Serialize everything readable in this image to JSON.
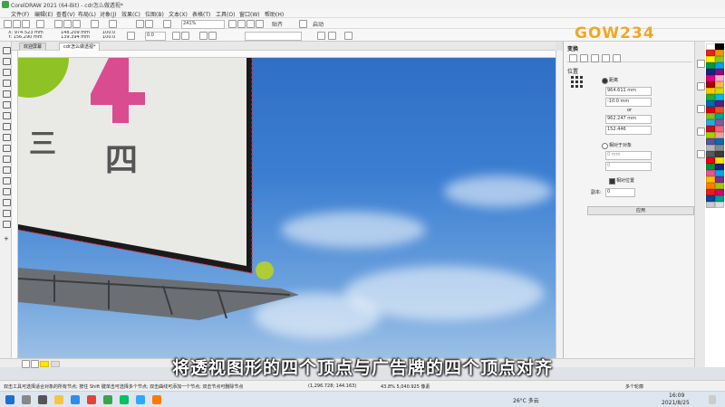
{
  "window": {
    "title": "CorelDRAW 2021 (64-Bit) - cdr怎么做透视*"
  },
  "menu": [
    "文件(F)",
    "编辑(E)",
    "查看(V)",
    "布局(L)",
    "对象(J)",
    "效果(C)",
    "位图(B)",
    "文本(X)",
    "表格(T)",
    "工具(O)",
    "窗口(W)",
    "帮助(H)"
  ],
  "toolbar": {
    "zoom": "241%",
    "snap_label": "贴齐",
    "launch_label": "启动"
  },
  "propbar": {
    "x": "X: 974.523 mm",
    "y": "Y: 156.290 mm",
    "w": "148.209 mm",
    "h": "139.394 mm",
    "sx": "100.0",
    "sy": "100.0",
    "pct": "%",
    "angle": "0.0"
  },
  "tabs": [
    "欢迎屏幕",
    "cdr怎么做透视*"
  ],
  "panel": {
    "header": "变换",
    "section": "位置",
    "distance_label": "距离",
    "x_val": "964.611 mm",
    "y_val": "-10.0 mm",
    "or_label": "or",
    "len_val": "962.247 mm",
    "angle_val": "152.446",
    "relative_label": "相对于对象",
    "dist2": "0 mm",
    "ang2": "0",
    "relpos_label": "相对位置",
    "copies_label": "副本:",
    "copies_val": "0",
    "apply_label": "应用"
  },
  "billboard": {
    "line1": "三",
    "line2": "四"
  },
  "subtitle": "将透视图形的四个顶点与广告牌的四个顶点对齐",
  "watermark": "GOW234",
  "status": {
    "hint": "双击工具可选择适合对象的所有节点; 按住 Shift 键单击可选择多个节点; 双击曲线可添加一个节点; 双击节点可删除节点",
    "coords": "(1,296.728; 144.163)",
    "info": "43.8%  5,040.925  像素",
    "nodes": "多个轮廓"
  },
  "tray": {
    "weather": "26°C 多云",
    "time": "16:09",
    "date": "2021/8/25"
  },
  "colors": {
    "accent": "#3ba34a",
    "brand_orange": "#f4a526",
    "sky": "#3c7fd2",
    "magenta": "#d94c8f",
    "lime": "#8fc225"
  }
}
